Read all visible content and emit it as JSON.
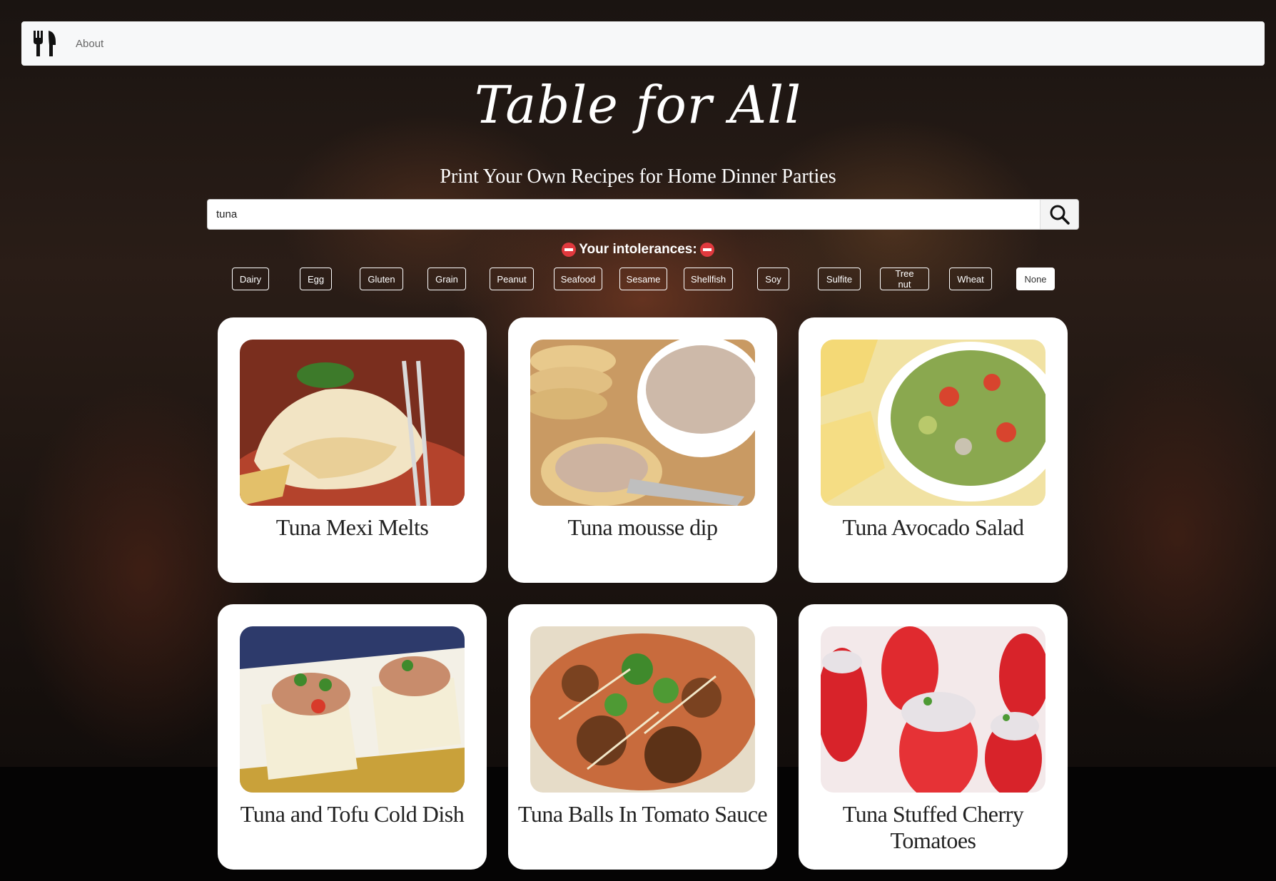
{
  "nav": {
    "about_label": "About",
    "logo_icon": "fork-knife-icon"
  },
  "hero": {
    "title": "Table for All",
    "subtitle": "Print Your Own Recipes for Home Dinner Parties"
  },
  "search": {
    "value": "tuna",
    "icon": "search-icon"
  },
  "intolerances": {
    "heading": "Your intolerances:",
    "options": [
      "Dairy",
      "Egg",
      "Gluten",
      "Grain",
      "Peanut",
      "Seafood",
      "Sesame",
      "Shellfish",
      "Soy",
      "Sulfite",
      "Tree nut",
      "Wheat",
      "None"
    ],
    "selected": "None"
  },
  "recipes": [
    {
      "title": "Tuna Mexi Melts"
    },
    {
      "title": "Tuna mousse dip"
    },
    {
      "title": "Tuna Avocado Salad"
    },
    {
      "title": "Tuna and Tofu Cold Dish"
    },
    {
      "title": "Tuna Balls In Tomato Sauce"
    },
    {
      "title": "Tuna Stuffed Cherry Tomatoes"
    }
  ]
}
